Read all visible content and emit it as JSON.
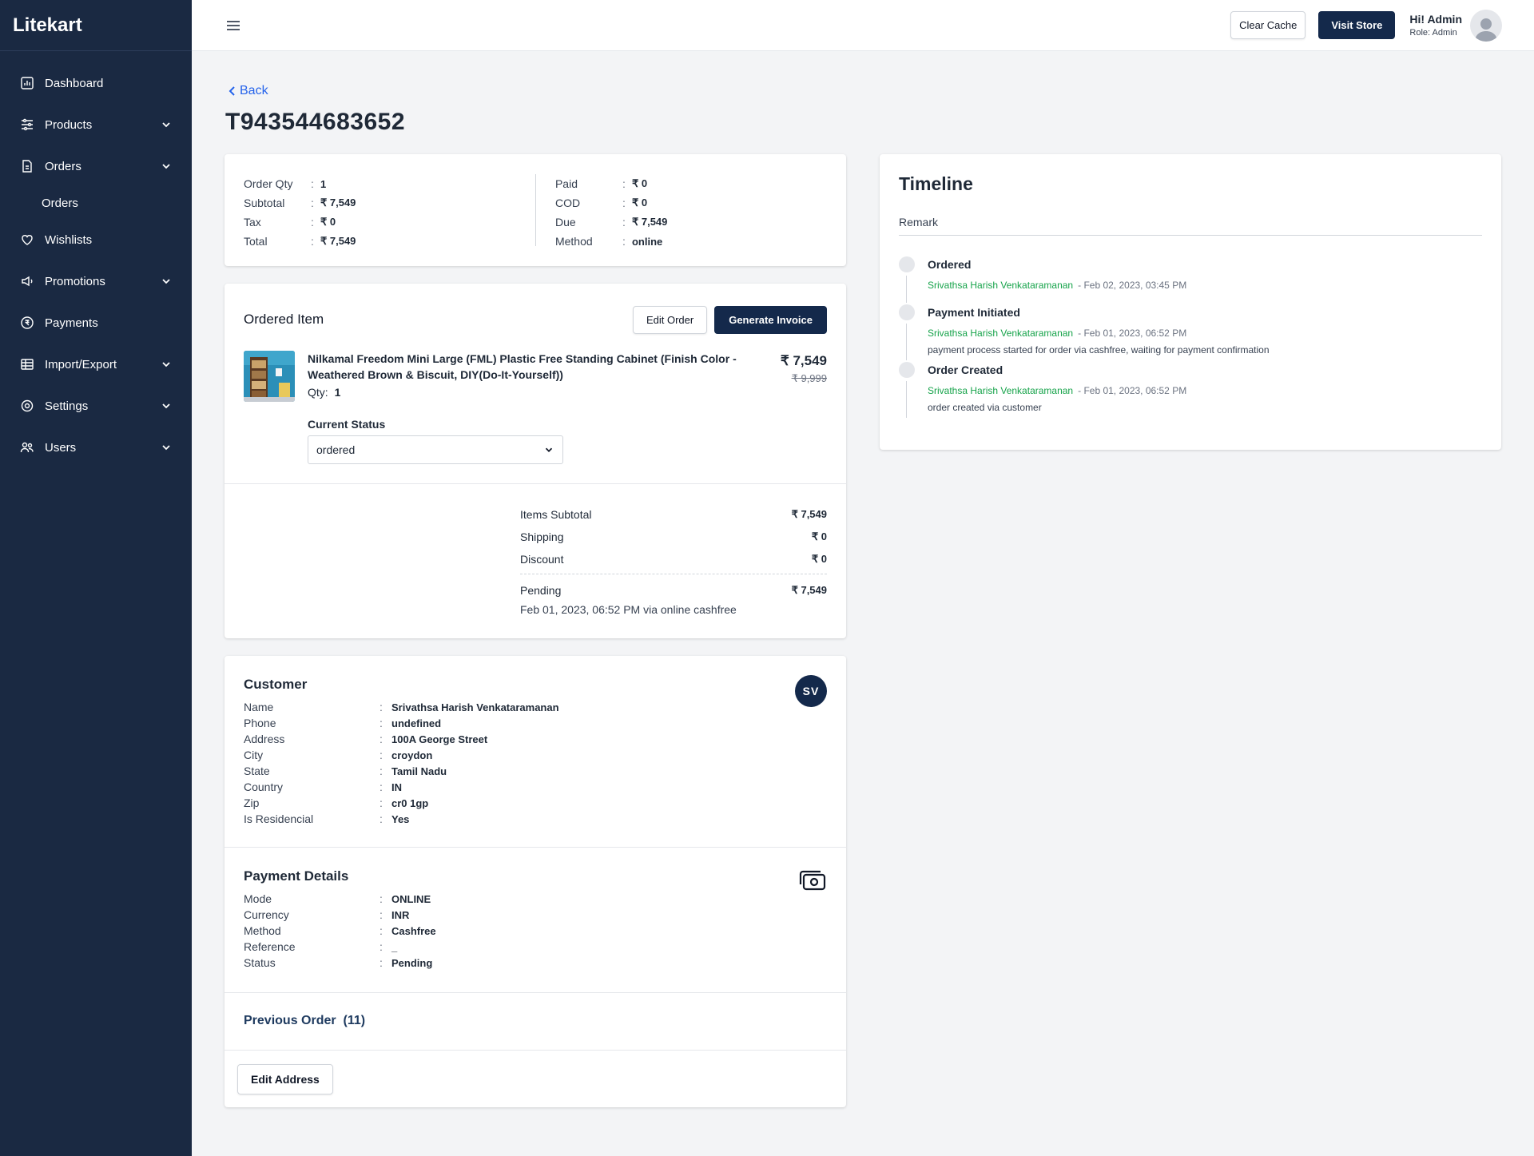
{
  "brand": "Litekart",
  "sidebar": {
    "items": [
      {
        "label": "Dashboard"
      },
      {
        "label": "Products"
      },
      {
        "label": "Orders"
      },
      {
        "label": "Orders"
      },
      {
        "label": "Wishlists"
      },
      {
        "label": "Promotions"
      },
      {
        "label": "Payments"
      },
      {
        "label": "Import/Export"
      },
      {
        "label": "Settings"
      },
      {
        "label": "Users"
      }
    ]
  },
  "header": {
    "clear_cache": "Clear Cache",
    "visit_store": "Visit Store",
    "greeting": "Hi! Admin",
    "role": "Role: Admin"
  },
  "page": {
    "back": "Back",
    "title": "T943544683652"
  },
  "summary": {
    "left": [
      {
        "k": "Order Qty",
        "v": "1"
      },
      {
        "k": "Subtotal",
        "v": "₹ 7,549"
      },
      {
        "k": "Tax",
        "v": "₹ 0"
      },
      {
        "k": "Total",
        "v": "₹ 7,549"
      }
    ],
    "right": [
      {
        "k": "Paid",
        "v": "₹ 0"
      },
      {
        "k": "COD",
        "v": "₹ 0"
      },
      {
        "k": "Due",
        "v": "₹ 7,549"
      },
      {
        "k": "Method",
        "v": "online"
      }
    ],
    "sep": ":"
  },
  "ordered": {
    "title": "Ordered Item",
    "edit_order": "Edit Order",
    "generate_invoice": "Generate Invoice",
    "product_name": "Nilkamal Freedom Mini Large (FML) Plastic Free Standing Cabinet (Finish Color - Weathered Brown & Biscuit, DIY(Do-It-Yourself))",
    "qty_label": "Qty:",
    "qty": "1",
    "price": "₹ 7,549",
    "mrp": "₹ 9,999",
    "status_label": "Current Status",
    "status_value": "ordered",
    "totals": [
      {
        "k": "Items Subtotal",
        "v": "₹ 7,549"
      },
      {
        "k": "Shipping",
        "v": "₹ 0"
      },
      {
        "k": "Discount",
        "v": "₹ 0"
      }
    ],
    "pending_label": "Pending",
    "pending_value": "₹ 7,549",
    "pending_note": "Feb 01, 2023, 06:52 PM via online cashfree"
  },
  "customer": {
    "title": "Customer",
    "initials": "SV",
    "rows": [
      {
        "k": "Name",
        "v": "Srivathsa Harish Venkataramanan"
      },
      {
        "k": "Phone",
        "v": "undefined"
      },
      {
        "k": "Address",
        "v": "100A George Street"
      },
      {
        "k": "City",
        "v": "croydon"
      },
      {
        "k": "State",
        "v": "Tamil Nadu"
      },
      {
        "k": "Country",
        "v": "IN"
      },
      {
        "k": "Zip",
        "v": "cr0 1gp"
      },
      {
        "k": "Is Residencial",
        "v": "Yes"
      }
    ]
  },
  "payment": {
    "title": "Payment Details",
    "rows": [
      {
        "k": "Mode",
        "v": "ONLINE"
      },
      {
        "k": "Currency",
        "v": "INR"
      },
      {
        "k": "Method",
        "v": "Cashfree"
      },
      {
        "k": "Reference",
        "v": "_"
      },
      {
        "k": "Status",
        "v": "Pending"
      }
    ]
  },
  "previous_order": "Previous Order  (11)",
  "edit_address": "Edit Address",
  "timeline": {
    "title": "Timeline",
    "remark_placeholder": "Remark",
    "events": [
      {
        "title": "Ordered",
        "actor": "Srivathsa Harish Venkataramanan",
        "when": "- Feb 02, 2023, 03:45 PM",
        "note": ""
      },
      {
        "title": "Payment Initiated",
        "actor": "Srivathsa Harish Venkataramanan",
        "when": "- Feb 01, 2023, 06:52 PM",
        "note": "payment process started for order via cashfree, waiting for payment confirmation"
      },
      {
        "title": "Order Created",
        "actor": "Srivathsa Harish Venkataramanan",
        "when": "- Feb 01, 2023, 06:52 PM",
        "note": "order created via customer"
      }
    ]
  },
  "colors": {
    "sidebar": "#1a2942",
    "primary": "#14294b",
    "link": "#2563eb",
    "actor": "#16a34a"
  }
}
